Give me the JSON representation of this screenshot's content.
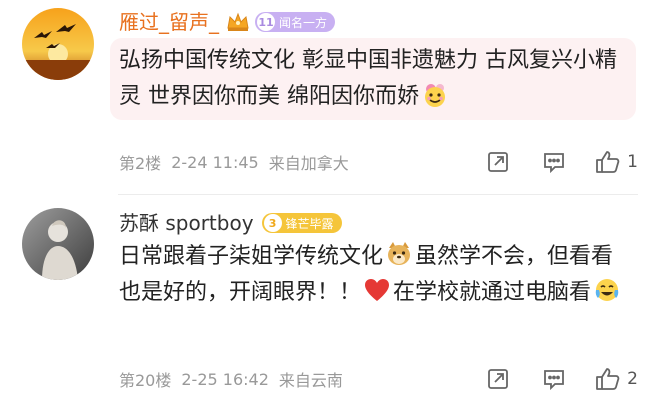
{
  "comments": [
    {
      "username": "雁过_留声_",
      "username_color": "#e8711f",
      "fan_badge": {
        "level": "11",
        "label": "闻名一方"
      },
      "content_parts": [
        "弘扬中国传统文化 彰显中国非遗魅力 古风复兴小精灵 世界因你而美 绵阳因你而娇"
      ],
      "emojis": [
        "flower-face-emoji"
      ],
      "floor": "第2楼",
      "date": "2-24 11:45",
      "location": "来自加拿大",
      "likes": "1"
    },
    {
      "username": "苏酥 sportboy",
      "username_color": "#333333",
      "fan_badge": {
        "level": "3",
        "label": "锋芒毕露"
      },
      "content_parts": [
        "日常跟着子柒姐学传统文化",
        "虽然学不会，但看看也是好的，开阔眼界！！",
        "在学校就通过电脑看"
      ],
      "emojis": [
        "doge-emoji",
        "red-heart-emoji",
        "tears-of-joy-emoji"
      ],
      "floor": "第20楼",
      "date": "2-25 16:42",
      "location": "来自云南",
      "likes": "2"
    }
  ],
  "colors": {
    "meta_text": "#999999",
    "bubble_bg": "#fdf1f2",
    "icon_gray": "#666666"
  }
}
